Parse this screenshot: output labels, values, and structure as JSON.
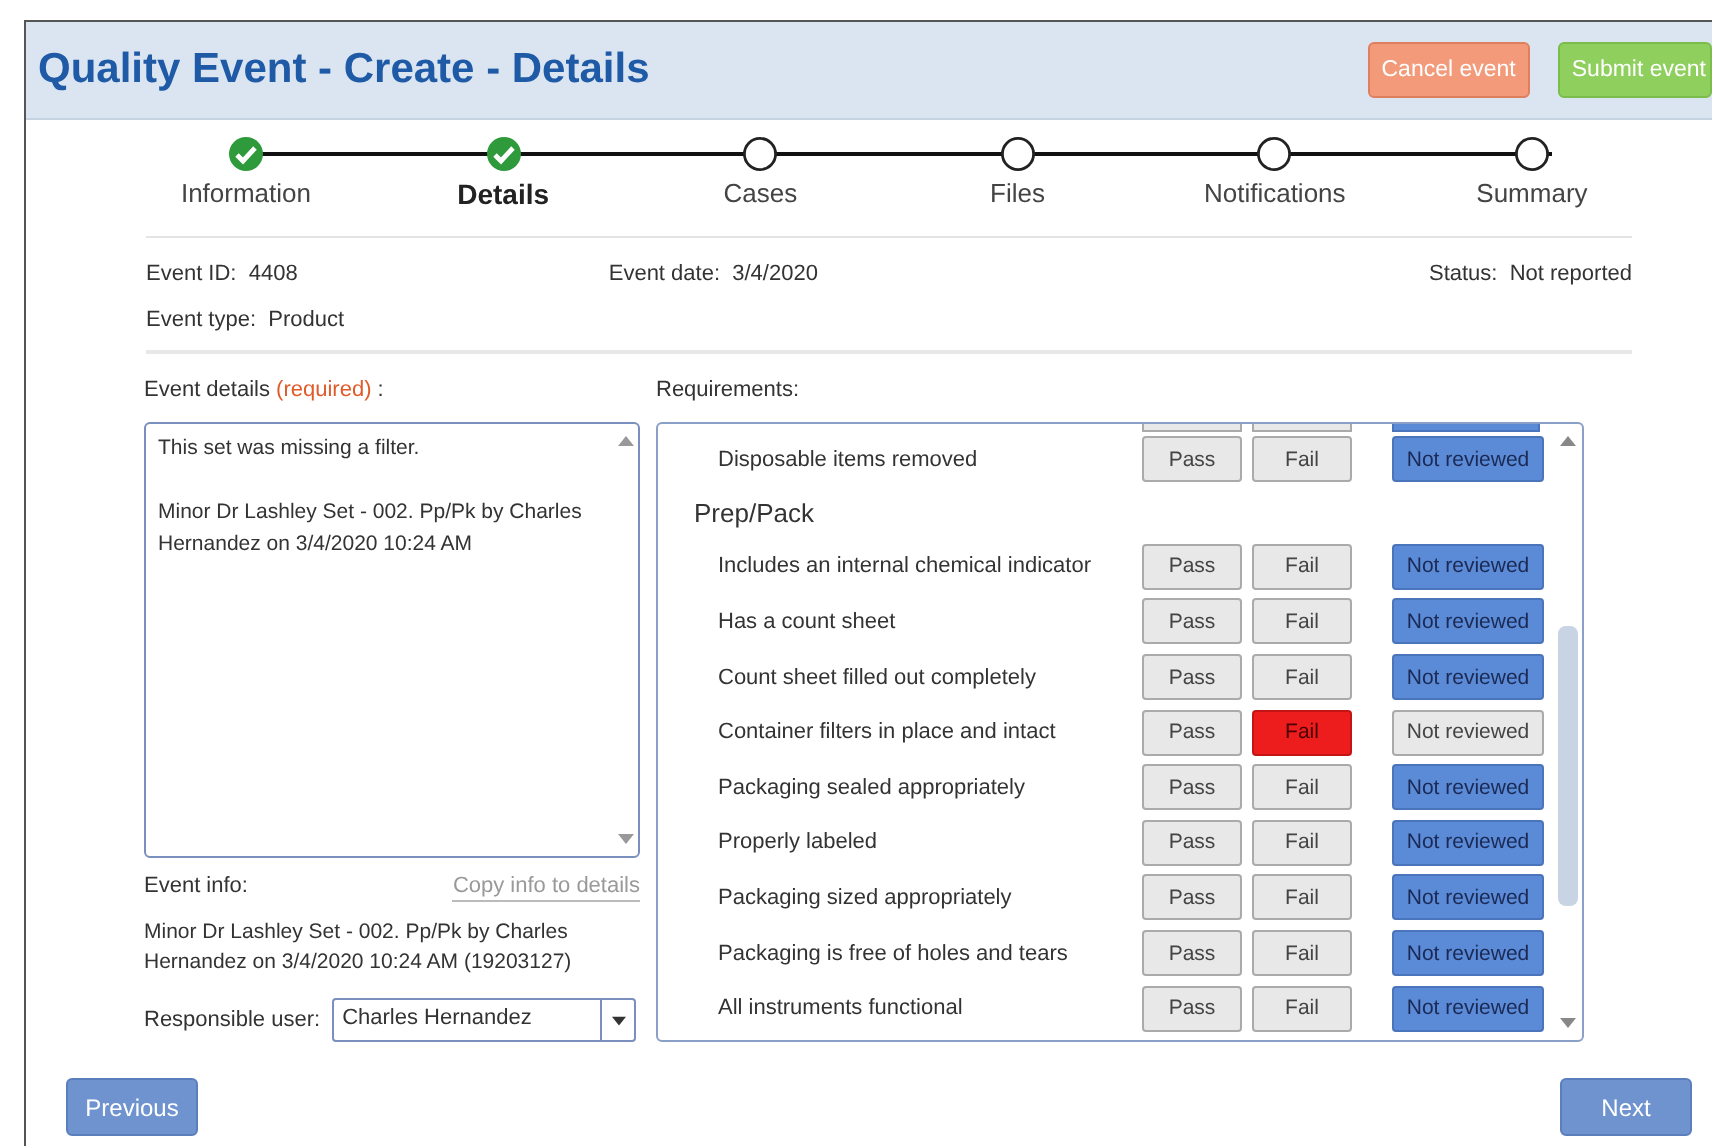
{
  "window": {
    "title": "Quality Event - Create - Details"
  },
  "header_buttons": [
    {
      "label": "Cancel event",
      "kind": "cancel"
    },
    {
      "label": "Submit event",
      "kind": "submit"
    }
  ],
  "steps": [
    {
      "label": "Information",
      "done": true,
      "selected": false
    },
    {
      "label": "Details",
      "done": true,
      "selected": true
    },
    {
      "label": "Cases",
      "done": false,
      "selected": false
    },
    {
      "label": "Files",
      "done": false,
      "selected": false
    },
    {
      "label": "Notifications",
      "done": false,
      "selected": false
    },
    {
      "label": "Summary",
      "done": false,
      "selected": false
    }
  ],
  "summary": {
    "event_id": {
      "label": "Event ID:",
      "value": "4408"
    },
    "event_date": {
      "label": "Event date:",
      "value": "3/4/2020"
    },
    "status": {
      "label": "Status:",
      "value": "Not reported"
    },
    "event_type": {
      "label": "Event type:",
      "value": "Product"
    }
  },
  "event_details": {
    "label": "Event details",
    "required": "(required)",
    "colon": ":",
    "value": "This set was missing a filter.\n\nMinor Dr Lashley Set - 002. Pp/Pk by Charles Hernandez on 3/4/2020 10:24 AM"
  },
  "event_info": {
    "label": "Event info:",
    "link": "Copy info to details",
    "text": "Minor Dr Lashley Set - 002. Pp/Pk by Charles Hernandez on 3/4/2020 10:24 AM (19203127)"
  },
  "responsible_user": {
    "label": "Responsible user:",
    "value": "Charles Hernandez"
  },
  "requirements": {
    "label": "Requirements:",
    "items": [
      {
        "kind": "row",
        "label": "Disposable items removed",
        "options": [
          {
            "label": "Pass",
            "selected": false
          },
          {
            "label": "Fail",
            "selected": false
          },
          {
            "label": "Not reviewed",
            "selected": true
          }
        ]
      },
      {
        "kind": "group",
        "label": "Prep/Pack"
      },
      {
        "kind": "row",
        "label": "Includes an internal chemical indicator",
        "options": [
          {
            "label": "Pass",
            "selected": false
          },
          {
            "label": "Fail",
            "selected": false
          },
          {
            "label": "Not reviewed",
            "selected": true
          }
        ]
      },
      {
        "kind": "row",
        "label": "Has a count sheet",
        "options": [
          {
            "label": "Pass",
            "selected": false
          },
          {
            "label": "Fail",
            "selected": false
          },
          {
            "label": "Not reviewed",
            "selected": true
          }
        ]
      },
      {
        "kind": "row",
        "label": "Count sheet filled out completely",
        "options": [
          {
            "label": "Pass",
            "selected": false
          },
          {
            "label": "Fail",
            "selected": false
          },
          {
            "label": "Not reviewed",
            "selected": true
          }
        ]
      },
      {
        "kind": "row",
        "label": "Container filters in place and intact",
        "options": [
          {
            "label": "Pass",
            "selected": false
          },
          {
            "label": "Fail",
            "selected": true
          },
          {
            "label": "Not reviewed",
            "selected": false
          }
        ]
      },
      {
        "kind": "row",
        "label": "Packaging sealed appropriately",
        "options": [
          {
            "label": "Pass",
            "selected": false
          },
          {
            "label": "Fail",
            "selected": false
          },
          {
            "label": "Not reviewed",
            "selected": true
          }
        ]
      },
      {
        "kind": "row",
        "label": "Properly labeled",
        "options": [
          {
            "label": "Pass",
            "selected": false
          },
          {
            "label": "Fail",
            "selected": false
          },
          {
            "label": "Not reviewed",
            "selected": true
          }
        ]
      },
      {
        "kind": "row",
        "label": "Packaging sized appropriately",
        "options": [
          {
            "label": "Pass",
            "selected": false
          },
          {
            "label": "Fail",
            "selected": false
          },
          {
            "label": "Not reviewed",
            "selected": true
          }
        ]
      },
      {
        "kind": "row",
        "label": "Packaging is free of holes and tears",
        "options": [
          {
            "label": "Pass",
            "selected": false
          },
          {
            "label": "Fail",
            "selected": false
          },
          {
            "label": "Not reviewed",
            "selected": true
          }
        ]
      },
      {
        "kind": "row",
        "label": "All instruments functional",
        "options": [
          {
            "label": "Pass",
            "selected": false
          },
          {
            "label": "Fail",
            "selected": false
          },
          {
            "label": "Not reviewed",
            "selected": true
          }
        ]
      }
    ]
  },
  "footer_buttons": [
    {
      "label": "Previous"
    },
    {
      "label": "Next"
    }
  ]
}
